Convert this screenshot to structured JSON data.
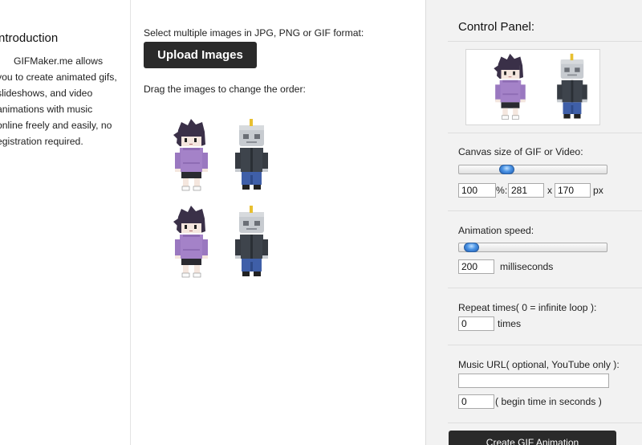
{
  "intro": {
    "title": "ntroduction",
    "lines": [
      "GIFMaker.me allows",
      "you to create animated gifs,",
      "slideshows, and video",
      "animations with music",
      "online freely and easily, no",
      "egistration required."
    ]
  },
  "upload": {
    "instruction": "Select multiple images in JPG, PNG or GIF format:",
    "button_label": "Upload Images",
    "drag_hint": "Drag the images to change the order:"
  },
  "images": [
    {
      "name": "purple-hoodie-character"
    },
    {
      "name": "robot-character"
    },
    {
      "name": "purple-hoodie-character"
    },
    {
      "name": "robot-character"
    }
  ],
  "panel": {
    "title": "Control Panel:",
    "canvas": {
      "label": "Canvas size of GIF or Video:",
      "slider_fraction": 0.27,
      "percent": "100",
      "percent_unit": "%:",
      "width": "281",
      "times_sign": "x",
      "height": "170",
      "px_unit": "px"
    },
    "speed": {
      "label": "Animation speed:",
      "slider_fraction": 0.03,
      "value": "200",
      "unit": "milliseconds"
    },
    "repeat": {
      "label": "Repeat times( 0 = infinite loop ):",
      "value": "0",
      "unit": "times"
    },
    "music": {
      "label": "Music URL( optional, YouTube only ):",
      "url": "",
      "begin": "0",
      "begin_unit": "( begin time in seconds )"
    },
    "create_label": "Create GIF Animation"
  },
  "colors": {
    "hoodie": "#a482c8",
    "hair": "#3a3048",
    "jacket": "#3e444c",
    "jeans": "#3f5fa8",
    "robot_head": "#c7cbd0",
    "button_dark": "#2a2a2a",
    "panel_bg": "#f2f2f2",
    "slider_handle": "#4c94e4"
  }
}
